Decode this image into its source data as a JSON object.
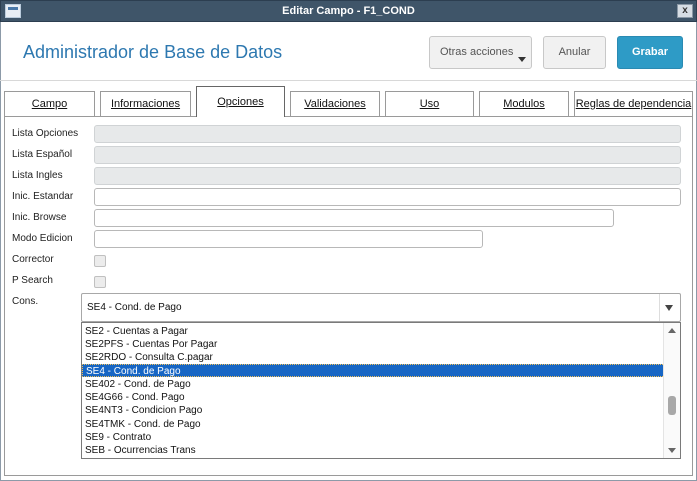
{
  "window": {
    "title": "Editar Campo - F1_COND",
    "close_label": "x"
  },
  "header": {
    "title": "Administrador de Base de Datos",
    "otras_label": "Otras acciones",
    "anular_label": "Anular",
    "grabar_label": "Grabar"
  },
  "tabs": [
    {
      "label": "Campo"
    },
    {
      "label": "Informaciones"
    },
    {
      "label": "Opciones",
      "active": true
    },
    {
      "label": "Validaciones"
    },
    {
      "label": "Uso"
    },
    {
      "label": "Modulos"
    },
    {
      "label": "Reglas de dependencia"
    }
  ],
  "form": {
    "lista_opciones": {
      "label": "Lista Opciones",
      "value": ""
    },
    "lista_espanol": {
      "label": "Lista Español",
      "value": ""
    },
    "lista_ingles": {
      "label": "Lista Ingles",
      "value": ""
    },
    "inic_estandar": {
      "label": "Inic. Estandar",
      "value": ""
    },
    "inic_browse": {
      "label": "Inic. Browse",
      "value": ""
    },
    "modo_edicion": {
      "label": "Modo Edicion",
      "value": ""
    },
    "corrector": {
      "label": "Corrector",
      "checked": false
    },
    "p_search": {
      "label": "P Search",
      "checked": false
    },
    "cons": {
      "label": "Cons.",
      "value": "SE4 - Cond. de Pago"
    }
  },
  "dropdown": {
    "options": [
      "SE2 - Cuentas a Pagar",
      "SE2PFS - Cuentas Por Pagar",
      "SE2RDO - Consulta C.pagar",
      "SE4 - Cond. de Pago",
      "SE402 - Cond. de Pago",
      "SE4G66 - Cond. Pago",
      "SE4NT3 - Condicion Pago",
      "SE4TMK - Cond. de Pago",
      "SE9 - Contrato",
      "SEB - Ocurrencias Trans"
    ],
    "selected_index": 3
  },
  "colors": {
    "accent": "#2e9bc6",
    "title": "#2d78b0",
    "selection": "#1766c4",
    "titlebar": "#3f5569"
  }
}
